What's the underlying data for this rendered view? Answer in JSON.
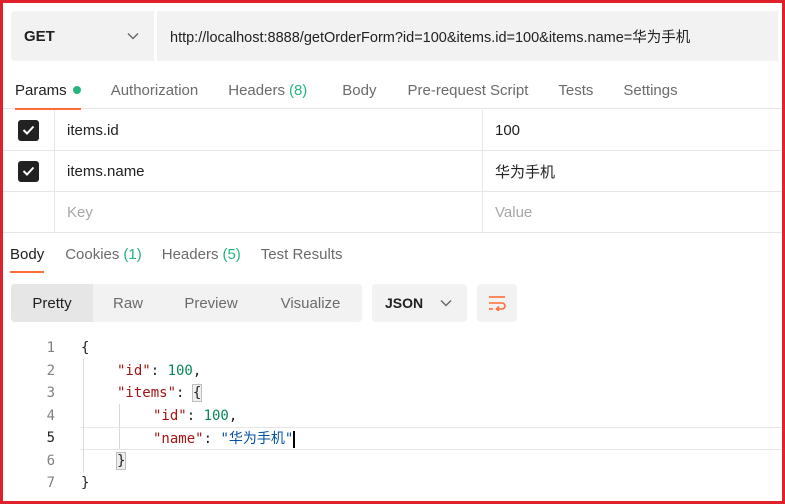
{
  "request": {
    "method": "GET",
    "url": "http://localhost:8888/getOrderForm?id=100&items.id=100&items.name=华为手机"
  },
  "request_tabs": [
    {
      "label": "Params",
      "active": true,
      "dot": true
    },
    {
      "label": "Authorization"
    },
    {
      "label": "Headers",
      "count": "(8)"
    },
    {
      "label": "Body"
    },
    {
      "label": "Pre-request Script"
    },
    {
      "label": "Tests"
    },
    {
      "label": "Settings"
    }
  ],
  "params": [
    {
      "key": "items.id",
      "value": "100",
      "checked": true
    },
    {
      "key": "items.name",
      "value": "华为手机",
      "checked": true
    }
  ],
  "params_placeholder": {
    "key": "Key",
    "value": "Value"
  },
  "response_tabs": [
    {
      "label": "Body",
      "active": true
    },
    {
      "label": "Cookies",
      "count": "(1)"
    },
    {
      "label": "Headers",
      "count": "(5)"
    },
    {
      "label": "Test Results"
    }
  ],
  "view_modes": [
    "Pretty",
    "Raw",
    "Preview",
    "Visualize"
  ],
  "format": "JSON",
  "code_lines": [
    {
      "num": "1",
      "text": "{"
    },
    {
      "num": "2",
      "text": "\"id\": 100,"
    },
    {
      "num": "3",
      "text": "\"items\": {"
    },
    {
      "num": "4",
      "text": "\"id\": 100,"
    },
    {
      "num": "5",
      "text": "\"name\": \"华为手机\""
    },
    {
      "num": "6",
      "text": "}"
    },
    {
      "num": "7",
      "text": "}"
    }
  ],
  "colors": {
    "accent": "#ff6c37",
    "success": "#26b47f",
    "frame": "#e0202a"
  },
  "icons": {
    "method_dropdown": "chevron-down-icon",
    "format_dropdown": "chevron-down-icon",
    "wrap": "wrap-lines-icon",
    "checkbox": "check-icon"
  }
}
